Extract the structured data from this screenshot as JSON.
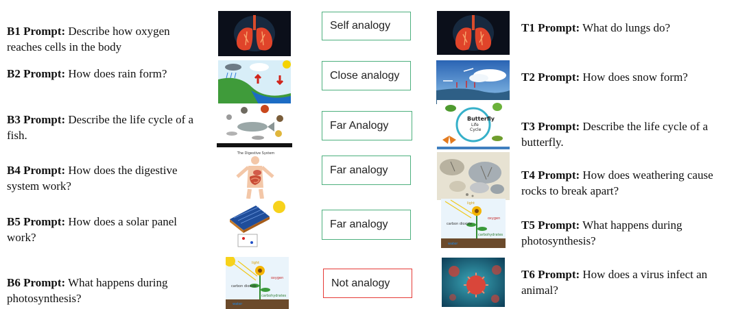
{
  "base": [
    {
      "id": "B1",
      "label": "B1 Prompt:",
      "text": "Describe how oxygen reaches cells in the body",
      "image": "lungs"
    },
    {
      "id": "B2",
      "label": "B2 Prompt:",
      "text": "How does rain form?",
      "image": "rain-cycle"
    },
    {
      "id": "B3",
      "label": "B3 Prompt:",
      "text": "Describe the life cycle of a fish.",
      "image": "fish-life-cycle"
    },
    {
      "id": "B4",
      "label": "B4 Prompt:",
      "text": "How does the digestive system work?",
      "image": "digestive-system",
      "image_caption": "The Digestive System"
    },
    {
      "id": "B5",
      "label": "B5 Prompt:",
      "text": "How does a solar panel work?",
      "image": "solar-panel"
    },
    {
      "id": "B6",
      "label": "B6 Prompt:",
      "text": "What happens during photosynthesis?",
      "image": "photosynthesis",
      "image_labels": [
        "light",
        "oxygen",
        "carbon dioxide",
        "carbohydrates",
        "water"
      ]
    }
  ],
  "analogies": [
    {
      "text": "Self analogy",
      "status": "green"
    },
    {
      "text": "Close analogy",
      "status": "green"
    },
    {
      "text": "Far Analogy",
      "status": "green"
    },
    {
      "text": "Far analogy",
      "status": "green"
    },
    {
      "text": "Far analogy",
      "status": "green"
    },
    {
      "text": "Not analogy",
      "status": "red"
    }
  ],
  "target": [
    {
      "id": "T1",
      "label": "T1 Prompt:",
      "text": "What do lungs do?",
      "image": "lungs"
    },
    {
      "id": "T2",
      "label": "T2 Prompt:",
      "text": "How does snow form?",
      "image": "snow-formation"
    },
    {
      "id": "T3",
      "label": "T3 Prompt:",
      "text": "Describe the life cycle of a butterfly.",
      "image": "butterfly-life-cycle",
      "image_labels": [
        "Butterfly",
        "Life",
        "Cycle"
      ]
    },
    {
      "id": "T4",
      "label": "T4 Prompt:",
      "text": "How does weathering cause rocks to break apart?",
      "image": "weathering-rocks"
    },
    {
      "id": "T5",
      "label": "T5 Prompt:",
      "text": "What happens during photosynthesis?",
      "image": "photosynthesis",
      "image_labels": [
        "light",
        "oxygen",
        "carbon dioxide",
        "carbohydrates",
        "water"
      ]
    },
    {
      "id": "T6",
      "label": "T6 Prompt:",
      "text": "How does a virus infect an animal?",
      "image": "virus"
    }
  ],
  "colors": {
    "analogy_green": "#4caf7d",
    "analogy_red": "#e53935"
  }
}
